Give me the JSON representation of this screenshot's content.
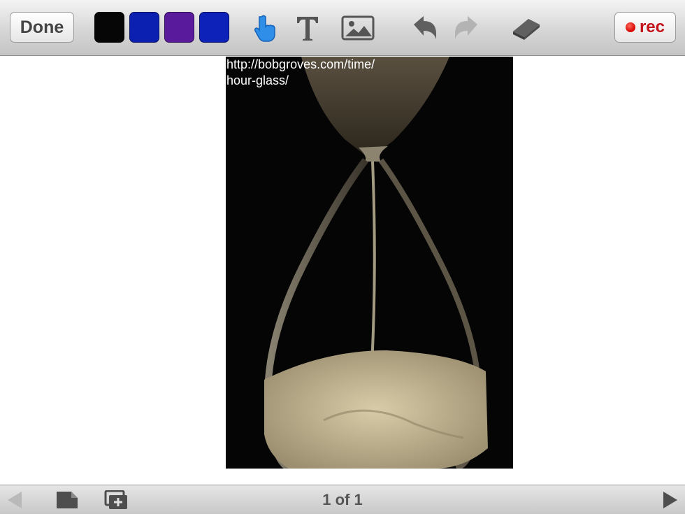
{
  "toolbar": {
    "done_label": "Done",
    "colors": [
      "#060606",
      "#0b1fb0",
      "#5a1a9c",
      "#0d22b8"
    ],
    "tools": [
      "pointer-hand-icon",
      "text-icon",
      "image-icon",
      "undo-icon",
      "redo-icon",
      "eraser-icon"
    ],
    "rec_label": "rec"
  },
  "canvas": {
    "caption_line1": "http://bobgroves.com/time/",
    "caption_line2": "hour-glass/"
  },
  "bottom": {
    "page_indicator": "1 of 1"
  }
}
